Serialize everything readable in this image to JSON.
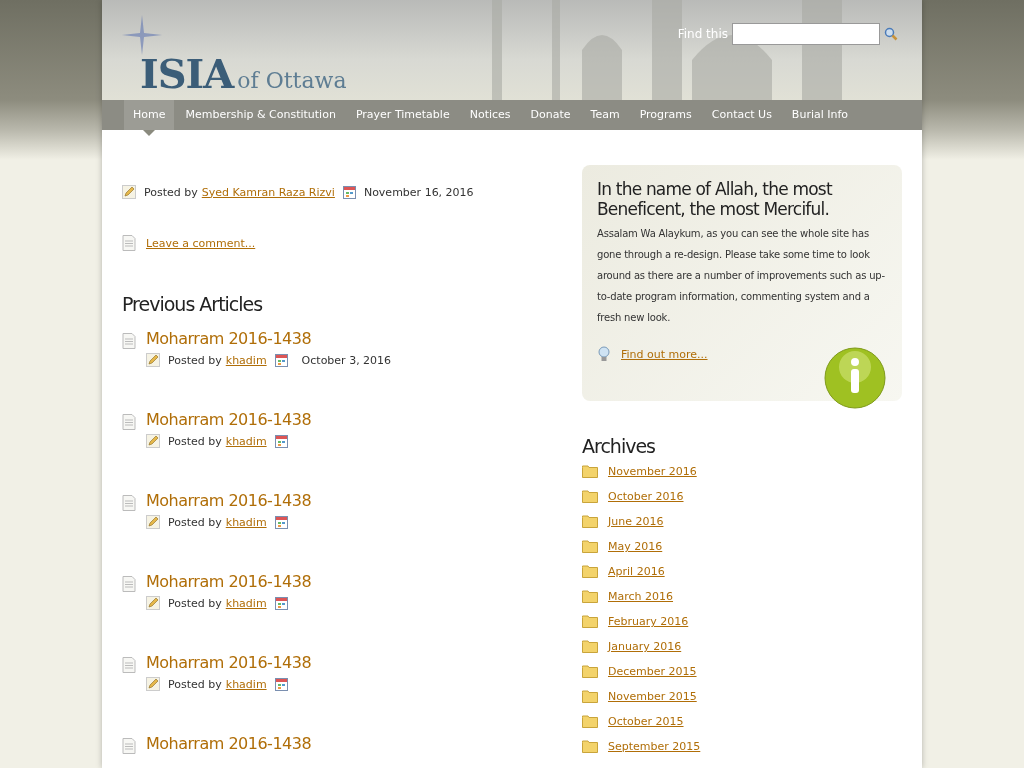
{
  "header": {
    "logo_main": "ISIA",
    "logo_sub": "of Ottawa",
    "search": {
      "label": "Find this"
    }
  },
  "nav": [
    {
      "label": "Home",
      "selected": true
    },
    {
      "label": "Membership & Constitution",
      "selected": false
    },
    {
      "label": "Prayer Timetable",
      "selected": false
    },
    {
      "label": "Notices",
      "selected": false
    },
    {
      "label": "Donate",
      "selected": false
    },
    {
      "label": "Team",
      "selected": false
    },
    {
      "label": "Programs",
      "selected": false
    },
    {
      "label": "Contact Us",
      "selected": false
    },
    {
      "label": "Burial Info",
      "selected": false
    }
  ],
  "post": {
    "posted_by": "Posted by",
    "author": "Syed Kamran Raza Rizvi",
    "date": "November 16, 2016",
    "comment_link": "Leave a comment..."
  },
  "previous_articles": {
    "title": "Previous Articles",
    "items": [
      {
        "title": "Moharram 2016-1438",
        "posted_by": "Posted by",
        "author": "khadim",
        "date": "October 3, 2016"
      },
      {
        "title": "Moharram 2016-1438",
        "posted_by": "Posted by",
        "author": "khadim"
      },
      {
        "title": "Moharram 2016-1438",
        "posted_by": "Posted by",
        "author": "khadim"
      },
      {
        "title": "Moharram 2016-1438",
        "posted_by": "Posted by",
        "author": "khadim"
      },
      {
        "title": "Moharram 2016-1438",
        "posted_by": "Posted by",
        "author": "khadim"
      },
      {
        "title": "Moharram 2016-1438"
      }
    ]
  },
  "welcome": {
    "title": "In the name of Allah, the most Beneficent, the most Merciful.",
    "body": "Assalam Wa Alaykum, as you can see the whole site has gone through a re-design. Please take some time to look around as there are a number of improvements such as up-to-date program information, commenting system and a fresh new look.",
    "link": "Find out more..."
  },
  "archives": {
    "title": "Archives",
    "items": [
      "November 2016",
      "October 2016",
      "June 2016",
      "May 2016",
      "April 2016",
      "March 2016",
      "February 2016",
      "January 2016",
      "December 2015",
      "November 2015",
      "October 2015",
      "September 2015"
    ]
  }
}
